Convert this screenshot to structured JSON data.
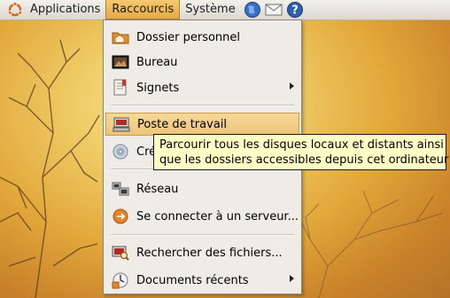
{
  "panel": {
    "applications_label": "Applications",
    "places_label": "Raccourcis",
    "system_label": "Système",
    "icons": [
      "ubuntu-logo-icon",
      "web-browser-icon",
      "mail-icon",
      "help-icon"
    ]
  },
  "menu": {
    "items": [
      {
        "label": "Dossier personnel",
        "icon": "home-folder-icon",
        "submenu": false
      },
      {
        "label": "Bureau",
        "icon": "desktop-icon",
        "submenu": false
      },
      {
        "label": "Signets",
        "icon": "bookmarks-icon",
        "submenu": true
      },
      {
        "label": "Poste de travail",
        "icon": "computer-icon",
        "submenu": false,
        "highlighted": true
      },
      {
        "label": "Cré",
        "icon": "cd-burner-icon",
        "submenu": false
      },
      {
        "label": "Réseau",
        "icon": "network-icon",
        "submenu": false
      },
      {
        "label": "Se connecter à un serveur...",
        "icon": "connect-server-icon",
        "submenu": false
      },
      {
        "label": "Rechercher des fichiers...",
        "icon": "search-files-icon",
        "submenu": false
      },
      {
        "label": "Documents récents",
        "icon": "recent-documents-icon",
        "submenu": true
      }
    ]
  },
  "tooltip": {
    "line1": "Parcourir tous les disques locaux et distants ainsi",
    "line2": "que les dossiers accessibles depuis cet ordinateur"
  },
  "colors": {
    "highlight": "#eec478",
    "menu_bg": "#efebe7",
    "tooltip_bg": "#fffdc6"
  }
}
